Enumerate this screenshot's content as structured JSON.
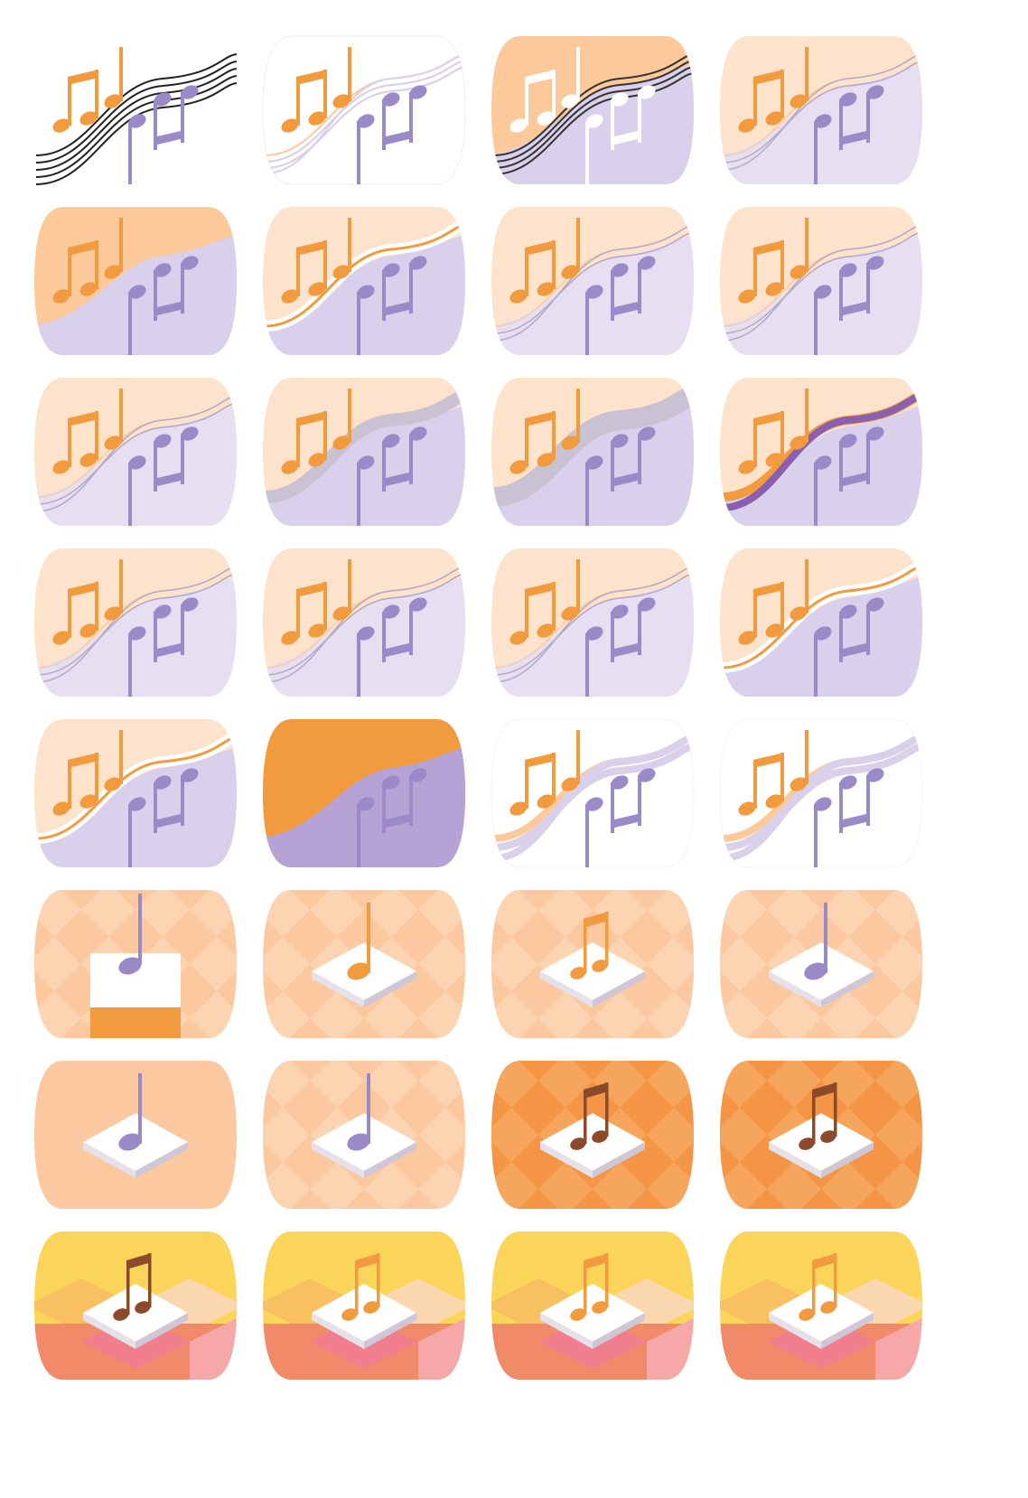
{
  "sheet": {
    "columns": 4,
    "rows": 8,
    "colors": {
      "orange": "#f29a3e",
      "orange_light": "#fbc99a",
      "orange_pale": "#fde3cc",
      "lavender": "#9b8ac8",
      "lavender_light": "#d9d0ec",
      "purple_deep": "#8a5fb0",
      "peach_bg": "#fbc8a0",
      "peach_check": "#fdd8b8",
      "orange_bg": "#f39545",
      "orange_check": "#f7ac66",
      "brown_note": "#8b4a2a",
      "yellow": "#fbd55a",
      "coral": "#f08a68",
      "pink": "#f07e8c",
      "tile_white": "#ffffff"
    },
    "icons": [
      {
        "id": "r1c1",
        "family": "wave",
        "variant": "lineart-staff"
      },
      {
        "id": "r1c2",
        "family": "wave",
        "variant": "white-oval-colored-staff"
      },
      {
        "id": "r1c3",
        "family": "wave",
        "variant": "dark-staff-white-notes"
      },
      {
        "id": "r1c4",
        "family": "wave",
        "variant": "soft-gradient-wave"
      },
      {
        "id": "r2c1",
        "family": "wave",
        "variant": "split-flat"
      },
      {
        "id": "r2c2",
        "family": "wave",
        "variant": "split-white-ribbon"
      },
      {
        "id": "r2c3",
        "family": "wave",
        "variant": "split-grey-line"
      },
      {
        "id": "r2c4",
        "family": "wave",
        "variant": "light-with-lines"
      },
      {
        "id": "r3c1",
        "family": "wave",
        "variant": "light-thin-lines"
      },
      {
        "id": "r3c2",
        "family": "wave",
        "variant": "grey-band"
      },
      {
        "id": "r3c3",
        "family": "wave",
        "variant": "grey-band-wide"
      },
      {
        "id": "r3c4",
        "family": "wave",
        "variant": "purple-band"
      },
      {
        "id": "r4c1",
        "family": "wave",
        "variant": "lines-soft"
      },
      {
        "id": "r4c2",
        "family": "wave",
        "variant": "lines-grey"
      },
      {
        "id": "r4c3",
        "family": "wave",
        "variant": "lines-lavender"
      },
      {
        "id": "r4c4",
        "family": "wave",
        "variant": "white-ribbon-orange-edge"
      },
      {
        "id": "r5c1",
        "family": "wave",
        "variant": "ribbon-swoosh"
      },
      {
        "id": "r5c2",
        "family": "wave",
        "variant": "bold-split"
      },
      {
        "id": "r5c3",
        "family": "wave",
        "variant": "open-white-bands"
      },
      {
        "id": "r5c4",
        "family": "wave",
        "variant": "open-white-lines"
      },
      {
        "id": "r6c1",
        "family": "tile",
        "variant": "cube-lavender-note"
      },
      {
        "id": "r6c2",
        "family": "tile",
        "variant": "diamond-orange-note"
      },
      {
        "id": "r6c3",
        "family": "tile",
        "variant": "diamond-orange-double"
      },
      {
        "id": "r6c4",
        "family": "tile",
        "variant": "diamond-lavender-note"
      },
      {
        "id": "r7c1",
        "family": "tile",
        "variant": "plain-peach-lavender"
      },
      {
        "id": "r7c2",
        "family": "tile",
        "variant": "checker-peach-lavender"
      },
      {
        "id": "r7c3",
        "family": "tile",
        "variant": "orange-brown-double"
      },
      {
        "id": "r7c4",
        "family": "tile",
        "variant": "orange-checker-brown-double"
      },
      {
        "id": "r8c1",
        "family": "tile",
        "variant": "sunset-brown-double"
      },
      {
        "id": "r8c2",
        "family": "tile",
        "variant": "sunset-orange-double"
      },
      {
        "id": "r8c3",
        "family": "tile",
        "variant": "sunset-bright-orange-double"
      },
      {
        "id": "r8c4",
        "family": "tile",
        "variant": "sunset-soft-orange-double"
      }
    ]
  }
}
